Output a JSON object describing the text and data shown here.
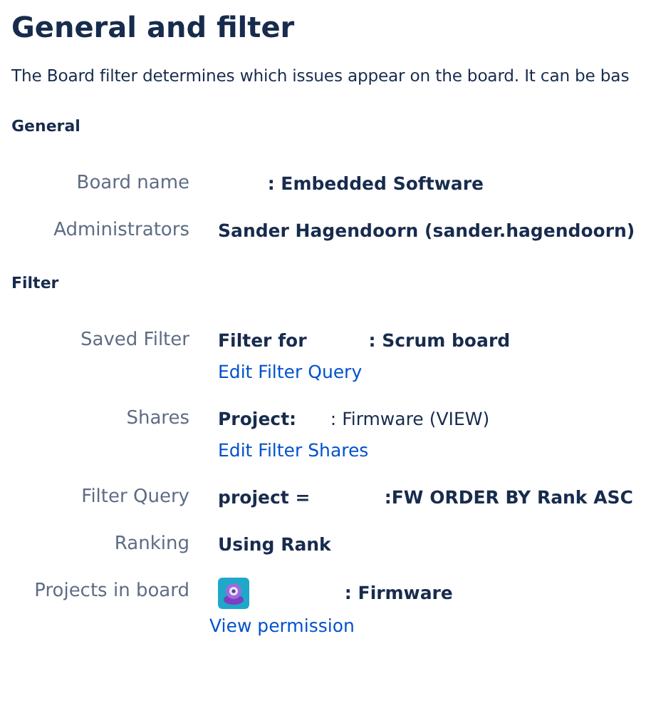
{
  "title": "General and filter",
  "description": "The Board filter determines which issues appear on the board. It can be bas",
  "sections": [
    {
      "title": "General",
      "rows": [
        {
          "kind": "text",
          "label": "Board name",
          "value": "        : Embedded Software"
        },
        {
          "kind": "text",
          "label": "Administrators",
          "value": "Sander Hagendoorn (sander.hagendoorn)"
        }
      ]
    },
    {
      "title": "Filter",
      "rows": [
        {
          "kind": "text",
          "label": "Saved Filter",
          "value": "Filter for          : Scrum board",
          "link": "Edit Filter Query"
        },
        {
          "kind": "rich",
          "label": "Shares",
          "value": "**Project:**      : Firmware (VIEW)",
          "link": "Edit Filter Shares"
        },
        {
          "kind": "text",
          "label": "Filter Query",
          "value": "project =            :FW ORDER BY Rank ASC"
        },
        {
          "kind": "text",
          "label": "Ranking",
          "value": "Using Rank"
        },
        {
          "kind": "project",
          "label": "Projects in board",
          "value": "              : Firmware",
          "link": "View permission"
        }
      ]
    }
  ]
}
